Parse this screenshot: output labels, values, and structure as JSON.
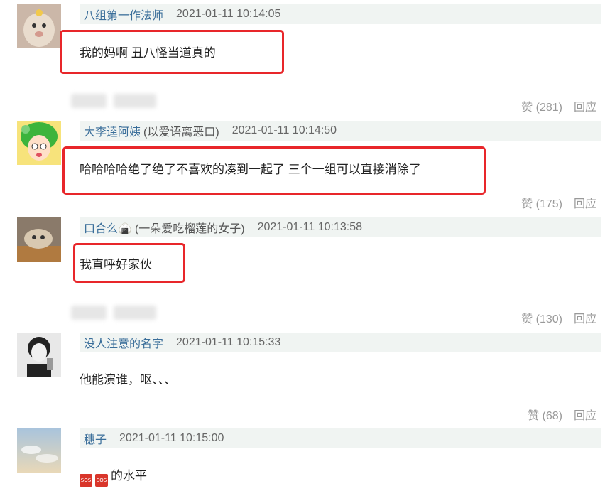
{
  "comments": [
    {
      "user": "八组第一作法师",
      "note": "",
      "time": "2021-01-11 10:14:05",
      "text": "我的妈啊 丑八怪当道真的",
      "likes": "赞 (281)",
      "reply": "回应",
      "highlighted": true
    },
    {
      "user": "大李逵阿姨",
      "note": "(以爱语离恶口)",
      "time": "2021-01-11 10:14:50",
      "text": "哈哈哈哈绝了绝了不喜欢的凑到一起了 三个一组可以直接消除了",
      "likes": "赞 (175)",
      "reply": "回应",
      "highlighted": true
    },
    {
      "user": "口合么🍙",
      "note": "(一朵爱吃榴莲的女子)",
      "time": "2021-01-11 10:13:58",
      "text": "我直呼好家伙",
      "likes": "赞 (130)",
      "reply": "回应",
      "highlighted": true
    },
    {
      "user": "没人注意的名字",
      "note": "",
      "time": "2021-01-11 10:15:33",
      "text": "他能演谁，呕、、、",
      "likes": "赞 (68)",
      "reply": "回应",
      "highlighted": false
    },
    {
      "user": "穗子",
      "note": "",
      "time": "2021-01-11 10:15:00",
      "text": "的水平",
      "emoji": [
        "SOS",
        "SOS"
      ],
      "highlighted": false
    }
  ],
  "colors": {
    "highlight": "#e8262a",
    "username": "#3a6e9a",
    "header_bg": "#f0f4f2"
  }
}
